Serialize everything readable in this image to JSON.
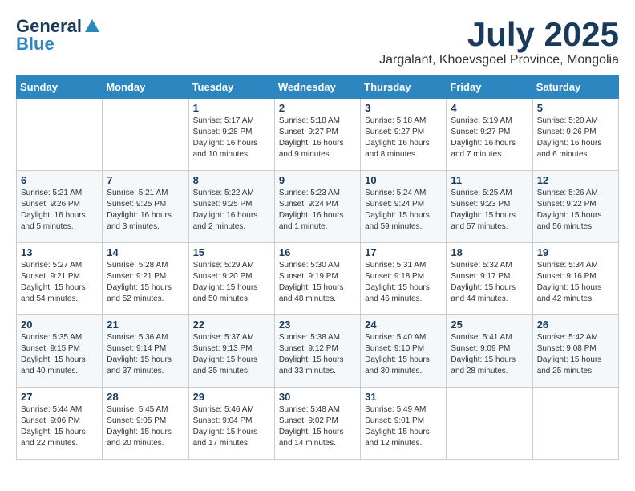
{
  "header": {
    "logo_line1": "General",
    "logo_line2": "Blue",
    "month": "July 2025",
    "location": "Jargalant, Khoevsgoel Province, Mongolia"
  },
  "weekdays": [
    "Sunday",
    "Monday",
    "Tuesday",
    "Wednesday",
    "Thursday",
    "Friday",
    "Saturday"
  ],
  "weeks": [
    [
      {
        "day": "",
        "sunrise": "",
        "sunset": "",
        "daylight": ""
      },
      {
        "day": "",
        "sunrise": "",
        "sunset": "",
        "daylight": ""
      },
      {
        "day": "1",
        "sunrise": "Sunrise: 5:17 AM",
        "sunset": "Sunset: 9:28 PM",
        "daylight": "Daylight: 16 hours and 10 minutes."
      },
      {
        "day": "2",
        "sunrise": "Sunrise: 5:18 AM",
        "sunset": "Sunset: 9:27 PM",
        "daylight": "Daylight: 16 hours and 9 minutes."
      },
      {
        "day": "3",
        "sunrise": "Sunrise: 5:18 AM",
        "sunset": "Sunset: 9:27 PM",
        "daylight": "Daylight: 16 hours and 8 minutes."
      },
      {
        "day": "4",
        "sunrise": "Sunrise: 5:19 AM",
        "sunset": "Sunset: 9:27 PM",
        "daylight": "Daylight: 16 hours and 7 minutes."
      },
      {
        "day": "5",
        "sunrise": "Sunrise: 5:20 AM",
        "sunset": "Sunset: 9:26 PM",
        "daylight": "Daylight: 16 hours and 6 minutes."
      }
    ],
    [
      {
        "day": "6",
        "sunrise": "Sunrise: 5:21 AM",
        "sunset": "Sunset: 9:26 PM",
        "daylight": "Daylight: 16 hours and 5 minutes."
      },
      {
        "day": "7",
        "sunrise": "Sunrise: 5:21 AM",
        "sunset": "Sunset: 9:25 PM",
        "daylight": "Daylight: 16 hours and 3 minutes."
      },
      {
        "day": "8",
        "sunrise": "Sunrise: 5:22 AM",
        "sunset": "Sunset: 9:25 PM",
        "daylight": "Daylight: 16 hours and 2 minutes."
      },
      {
        "day": "9",
        "sunrise": "Sunrise: 5:23 AM",
        "sunset": "Sunset: 9:24 PM",
        "daylight": "Daylight: 16 hours and 1 minute."
      },
      {
        "day": "10",
        "sunrise": "Sunrise: 5:24 AM",
        "sunset": "Sunset: 9:24 PM",
        "daylight": "Daylight: 15 hours and 59 minutes."
      },
      {
        "day": "11",
        "sunrise": "Sunrise: 5:25 AM",
        "sunset": "Sunset: 9:23 PM",
        "daylight": "Daylight: 15 hours and 57 minutes."
      },
      {
        "day": "12",
        "sunrise": "Sunrise: 5:26 AM",
        "sunset": "Sunset: 9:22 PM",
        "daylight": "Daylight: 15 hours and 56 minutes."
      }
    ],
    [
      {
        "day": "13",
        "sunrise": "Sunrise: 5:27 AM",
        "sunset": "Sunset: 9:21 PM",
        "daylight": "Daylight: 15 hours and 54 minutes."
      },
      {
        "day": "14",
        "sunrise": "Sunrise: 5:28 AM",
        "sunset": "Sunset: 9:21 PM",
        "daylight": "Daylight: 15 hours and 52 minutes."
      },
      {
        "day": "15",
        "sunrise": "Sunrise: 5:29 AM",
        "sunset": "Sunset: 9:20 PM",
        "daylight": "Daylight: 15 hours and 50 minutes."
      },
      {
        "day": "16",
        "sunrise": "Sunrise: 5:30 AM",
        "sunset": "Sunset: 9:19 PM",
        "daylight": "Daylight: 15 hours and 48 minutes."
      },
      {
        "day": "17",
        "sunrise": "Sunrise: 5:31 AM",
        "sunset": "Sunset: 9:18 PM",
        "daylight": "Daylight: 15 hours and 46 minutes."
      },
      {
        "day": "18",
        "sunrise": "Sunrise: 5:32 AM",
        "sunset": "Sunset: 9:17 PM",
        "daylight": "Daylight: 15 hours and 44 minutes."
      },
      {
        "day": "19",
        "sunrise": "Sunrise: 5:34 AM",
        "sunset": "Sunset: 9:16 PM",
        "daylight": "Daylight: 15 hours and 42 minutes."
      }
    ],
    [
      {
        "day": "20",
        "sunrise": "Sunrise: 5:35 AM",
        "sunset": "Sunset: 9:15 PM",
        "daylight": "Daylight: 15 hours and 40 minutes."
      },
      {
        "day": "21",
        "sunrise": "Sunrise: 5:36 AM",
        "sunset": "Sunset: 9:14 PM",
        "daylight": "Daylight: 15 hours and 37 minutes."
      },
      {
        "day": "22",
        "sunrise": "Sunrise: 5:37 AM",
        "sunset": "Sunset: 9:13 PM",
        "daylight": "Daylight: 15 hours and 35 minutes."
      },
      {
        "day": "23",
        "sunrise": "Sunrise: 5:38 AM",
        "sunset": "Sunset: 9:12 PM",
        "daylight": "Daylight: 15 hours and 33 minutes."
      },
      {
        "day": "24",
        "sunrise": "Sunrise: 5:40 AM",
        "sunset": "Sunset: 9:10 PM",
        "daylight": "Daylight: 15 hours and 30 minutes."
      },
      {
        "day": "25",
        "sunrise": "Sunrise: 5:41 AM",
        "sunset": "Sunset: 9:09 PM",
        "daylight": "Daylight: 15 hours and 28 minutes."
      },
      {
        "day": "26",
        "sunrise": "Sunrise: 5:42 AM",
        "sunset": "Sunset: 9:08 PM",
        "daylight": "Daylight: 15 hours and 25 minutes."
      }
    ],
    [
      {
        "day": "27",
        "sunrise": "Sunrise: 5:44 AM",
        "sunset": "Sunset: 9:06 PM",
        "daylight": "Daylight: 15 hours and 22 minutes."
      },
      {
        "day": "28",
        "sunrise": "Sunrise: 5:45 AM",
        "sunset": "Sunset: 9:05 PM",
        "daylight": "Daylight: 15 hours and 20 minutes."
      },
      {
        "day": "29",
        "sunrise": "Sunrise: 5:46 AM",
        "sunset": "Sunset: 9:04 PM",
        "daylight": "Daylight: 15 hours and 17 minutes."
      },
      {
        "day": "30",
        "sunrise": "Sunrise: 5:48 AM",
        "sunset": "Sunset: 9:02 PM",
        "daylight": "Daylight: 15 hours and 14 minutes."
      },
      {
        "day": "31",
        "sunrise": "Sunrise: 5:49 AM",
        "sunset": "Sunset: 9:01 PM",
        "daylight": "Daylight: 15 hours and 12 minutes."
      },
      {
        "day": "",
        "sunrise": "",
        "sunset": "",
        "daylight": ""
      },
      {
        "day": "",
        "sunrise": "",
        "sunset": "",
        "daylight": ""
      }
    ]
  ]
}
